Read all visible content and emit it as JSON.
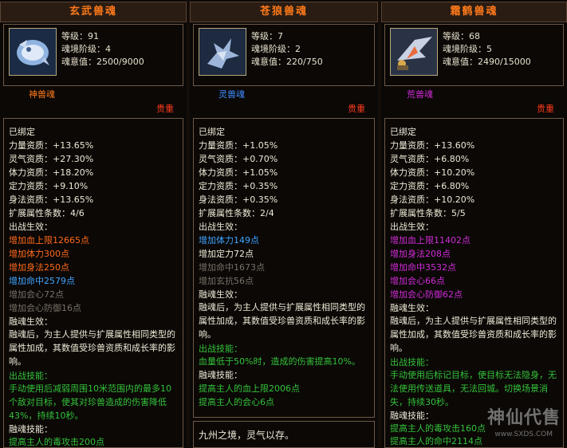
{
  "panels": [
    {
      "title": "玄武兽魂",
      "stats": [
        "等级：91",
        "魂境阶级：4",
        "魂意值：2500/9000"
      ],
      "type_label": "神兽魂",
      "precious": "贵重",
      "bound": "已绑定",
      "attrs": [
        "力量资质：+13.65%",
        "灵气资质：+27.30%",
        "体力资质：+18.20%",
        "定力资质：+9.10%",
        "身法资质：+13.65%"
      ],
      "ext_count": "扩展属性条数：4/6",
      "battle_effect_title": "出战生效：",
      "battle_effects": [
        {
          "text": "增加血上限12665点",
          "color": "orange"
        },
        {
          "text": "增加体力300点",
          "color": "orange"
        },
        {
          "text": "增加身法250点",
          "color": "orange"
        },
        {
          "text": "增加命中2579点",
          "color": "blue"
        },
        {
          "text": "增加会心72点",
          "color": "gray"
        },
        {
          "text": "增加会心防御16点",
          "color": "gray"
        }
      ],
      "fusion_title": "融魂生效：",
      "fusion_text": "融魂后，为主人提供与扩展属性相同类型的属性加成，其数值受珍兽资质和成长率的影响。",
      "skill_title": "出战技能：",
      "skill_text": "手动使用后减弱周围10米范围内的最多10个敌对目标，使其对珍兽造成的伤害降低43%，持续10秒。",
      "fusion_skill_title": "融魂技能：",
      "fusion_skill_text": "提高主人的毒攻击200点"
    },
    {
      "title": "苍狼兽魂",
      "stats": [
        "等级：7",
        "魂境阶级：2",
        "魂意值：220/750"
      ],
      "type_label": "灵兽魂",
      "precious": "贵重",
      "bound": "已绑定",
      "attrs": [
        "力量资质：+1.05%",
        "灵气资质：+0.70%",
        "体力资质：+1.05%",
        "定力资质：+0.35%",
        "身法资质：+0.35%"
      ],
      "ext_count": "扩展属性条数：2/4",
      "battle_effect_title": "出战生效：",
      "battle_effects": [
        {
          "text": "增加体力149点",
          "color": "blue"
        },
        {
          "text": "增加定力72点",
          "color": "white"
        },
        {
          "text": "增加命中1673点",
          "color": "gray"
        },
        {
          "text": "增加玄抗56点",
          "color": "gray"
        }
      ],
      "fusion_title": "融魂生效：",
      "fusion_text": "融魂后，为主人提供与扩展属性相同类型的属性加成，其数值受珍兽资质和成长率的影响。",
      "skill_title": "出战技能：",
      "skill_text": "血量低于50%时，造成的伤害提高10%。",
      "fusion_skill_title": "融魂技能：",
      "fusion_skill_text1": "提高主人的血上限2006点",
      "fusion_skill_text2": "提高主人的会心6点",
      "footer_text": "九州之境，灵气以存。"
    },
    {
      "title": "霜鹤兽魂",
      "stats": [
        "等级：68",
        "魂境阶级：5",
        "魂意值：2490/15000"
      ],
      "type_label": "荒兽魂",
      "precious": "贵重",
      "bound": "已绑定",
      "attrs": [
        "力量资质：+13.60%",
        "灵气资质：+6.80%",
        "体力资质：+10.20%",
        "定力资质：+6.80%",
        "身法资质：+10.20%"
      ],
      "ext_count": "扩展属性条数：5/5",
      "battle_effect_title": "出战生效：",
      "battle_effects": [
        {
          "text": "增加血上限11402点",
          "color": "pink"
        },
        {
          "text": "增加身法208点",
          "color": "pink"
        },
        {
          "text": "增加命中3532点",
          "color": "pink"
        },
        {
          "text": "增加会心66点",
          "color": "pink"
        },
        {
          "text": "增加会心防御62点",
          "color": "pink"
        }
      ],
      "fusion_title": "融魂生效：",
      "fusion_text": "融魂后，为主人提供与扩展属性相同类型的属性加成，其数值受珍兽资质和成长率的影响。",
      "skill_title": "出战技能：",
      "skill_text": "手动使用后标记目标，使目标无法隐身，无法使用传送道具，无法回城。切换场景消失，持续30秒。",
      "fusion_skill_title": "融魂技能：",
      "fusion_skill_text1": "提高主人的毒攻击160点",
      "fusion_skill_text2": "提高主人的命中2114点"
    }
  ],
  "watermark": {
    "big": "神仙代售",
    "small": "www.SXDS.COM"
  },
  "colors": {
    "title": "#ff7a1a",
    "precious": "#ff3a1c",
    "orange": "#ff6a1a",
    "blue": "#3fa4ff",
    "green": "#34c23a",
    "pink": "#d12bd8",
    "gray": "#7a7067"
  }
}
